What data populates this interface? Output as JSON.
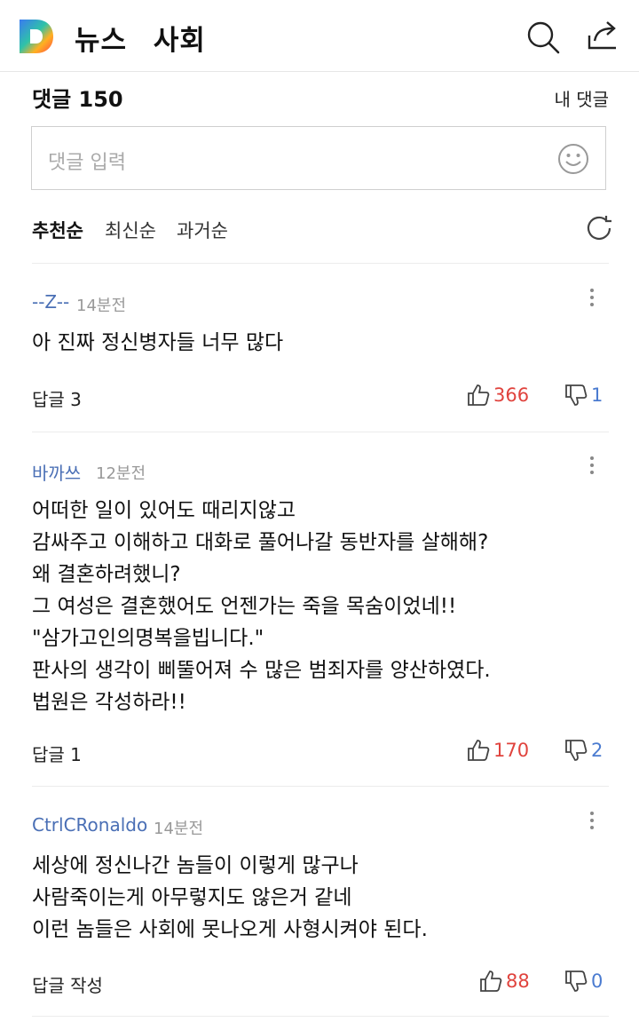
{
  "header": {
    "section": "뉴스",
    "category": "사회"
  },
  "comments_header": {
    "count_label": "댓글 150",
    "my_comments": "내 댓글"
  },
  "input": {
    "placeholder": "댓글 입력"
  },
  "sort": {
    "items": [
      "추천순",
      "최신순",
      "과거순"
    ],
    "active": "추천순"
  },
  "comments": [
    {
      "author": "--Z--",
      "time": "14분전",
      "text": "아 진짜 정신병자들 너무 많다",
      "reply": "답글 3",
      "likes": "366",
      "dislikes": "1"
    },
    {
      "author": "바까쓰",
      "time": "12분전",
      "text": "어떠한 일이 있어도 때리지않고\n감싸주고 이해하고 대화로 풀어나갈  동반자를 살해해?\n왜 결혼하려했니?\n그 여성은 결혼했어도 언젠가는 죽을 목숨이었네!!\n\"삼가고인의명복을빕니다.\"\n판사의 생각이 삐뚤어져 수 많은 범죄자를 양산하였다.\n법원은 각성하라!!",
      "reply": "답글 1",
      "likes": "170",
      "dislikes": "2"
    },
    {
      "author": "CtrlCRonaldo",
      "time": "14분전",
      "text": "세상에 정신나간 놈들이 이렇게 많구나\n사람죽이는게 아무렇지도 않은거 같네\n이런 놈들은 사회에 못나오게 사형시켜야 된다.",
      "reply": "답글 작성",
      "likes": "88",
      "dislikes": "0"
    }
  ],
  "colors": {
    "author": "#4a6fb5",
    "like": "#e0433d",
    "dislike": "#4a7bd0"
  }
}
